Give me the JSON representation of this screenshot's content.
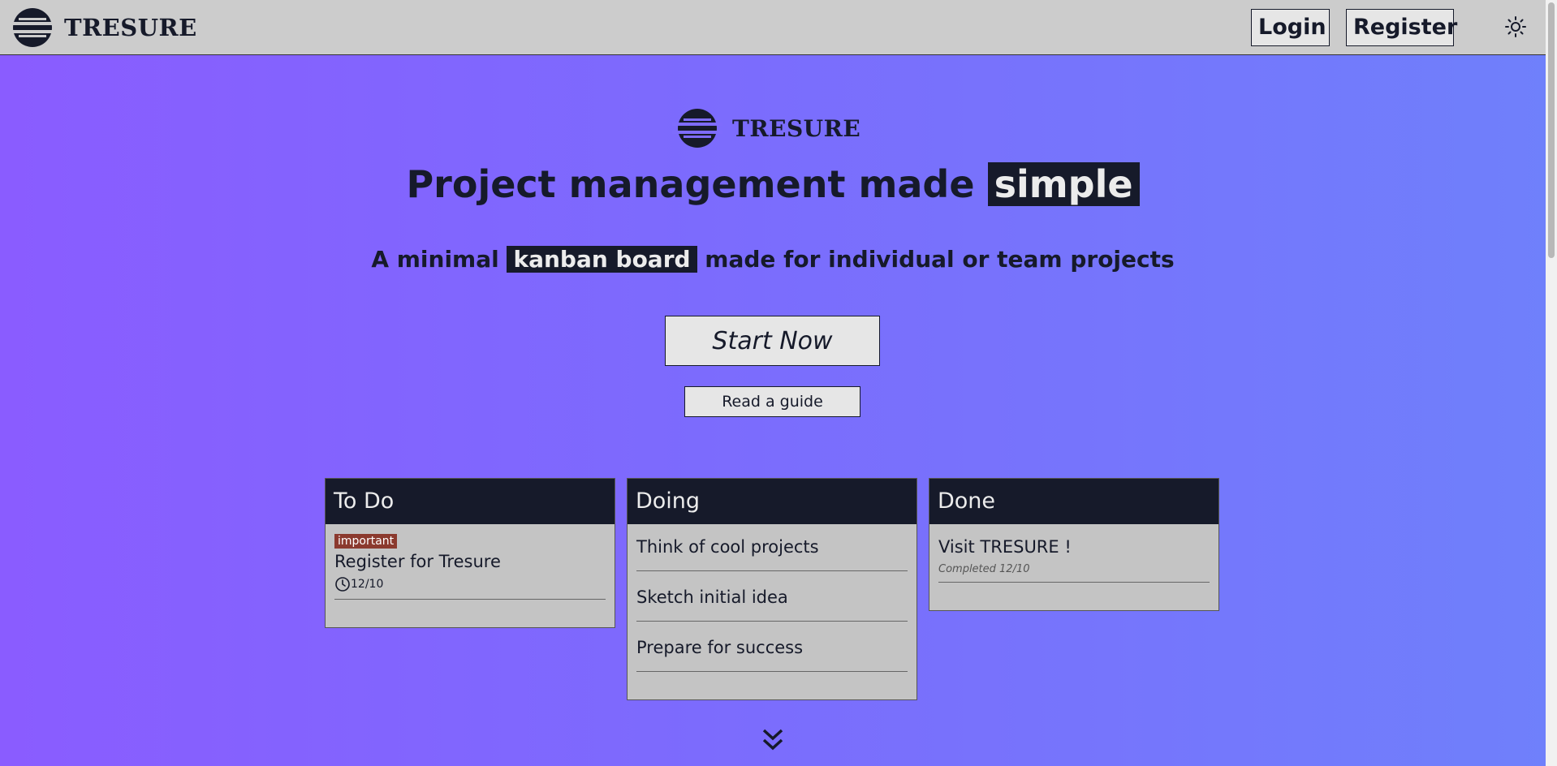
{
  "header": {
    "brand": "TRESURE",
    "login_label": "Login",
    "register_label": "Register",
    "theme_icon": "sun-icon"
  },
  "hero": {
    "brand": "TRESURE",
    "headline_prefix": "Project management made",
    "headline_highlight": "simple",
    "sub_prefix": "A minimal",
    "sub_highlight": "kanban board",
    "sub_suffix": "made for individual or team projects",
    "start_label": "Start Now",
    "guide_label": "Read a guide"
  },
  "board": {
    "todo": {
      "title": "To Do",
      "cards": [
        {
          "tag": "important",
          "title": "Register for Tresure",
          "due": "12/10"
        }
      ]
    },
    "doing": {
      "title": "Doing",
      "cards": [
        {
          "title": "Think of cool projects"
        },
        {
          "title": "Sketch initial idea"
        },
        {
          "title": "Prepare for success"
        }
      ]
    },
    "done": {
      "title": "Done",
      "cards": [
        {
          "title": "Visit TRESURE !",
          "completed": "Completed 12/10"
        }
      ]
    }
  },
  "colors": {
    "dark": "#161a2a",
    "header_bg": "#cccccc",
    "tag_important": "#8b3a2e",
    "gradient_start": "#8a5cff",
    "gradient_end": "#6f80fb"
  }
}
